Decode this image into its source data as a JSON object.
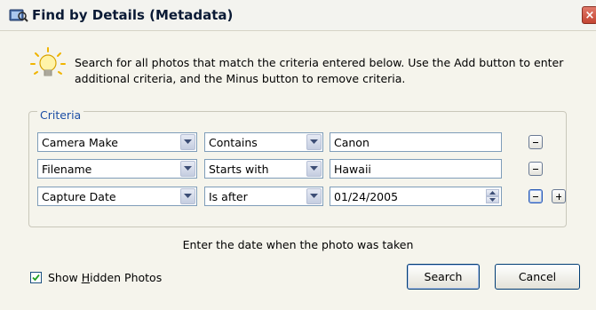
{
  "window": {
    "title": "Find by Details (Metadata)",
    "close_glyph": "×"
  },
  "intro": {
    "line1": "Search for all photos that match the criteria entered below.  Use the Add button to enter",
    "line2": "additional criteria, and the Minus button to remove criteria.",
    "icon": "lightbulb-icon"
  },
  "criteria": {
    "legend": "Criteria",
    "rows": [
      {
        "field": "Camera Make",
        "operator": "Contains",
        "value": "Canon"
      },
      {
        "field": "Filename",
        "operator": "Starts with",
        "value": "Hawaii"
      },
      {
        "field": "Capture Date",
        "operator": "Is after",
        "value": "01/24/2005"
      }
    ]
  },
  "hint": "Enter the date when the photo was taken",
  "show_hidden": {
    "label_pre": "Show ",
    "label_accel": "H",
    "label_post": "idden Photos",
    "checked": true
  },
  "buttons": {
    "search": "Search",
    "cancel": "Cancel"
  },
  "colors": {
    "accent": "#1c4ea5",
    "dialog_bg": "#f5f4ec",
    "field_border": "#7f9db9"
  }
}
